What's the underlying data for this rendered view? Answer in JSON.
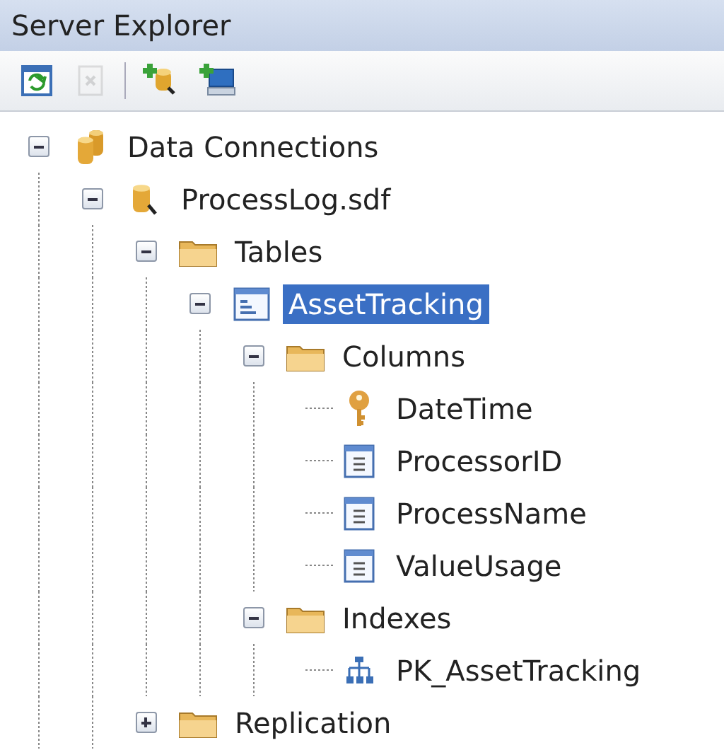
{
  "window": {
    "title": "Server Explorer"
  },
  "toolbar": [
    {
      "kind": "refresh",
      "disabled": false
    },
    {
      "kind": "delete",
      "disabled": true
    },
    {
      "kind": "add-connection",
      "disabled": false
    },
    {
      "kind": "add-server",
      "disabled": false
    }
  ],
  "tree": [
    {
      "label": "Data Connections",
      "kind": "databases",
      "expanded": true,
      "selected": false,
      "children": [
        {
          "label": "ProcessLog.sdf",
          "kind": "database",
          "expanded": true,
          "selected": false,
          "children": [
            {
              "label": "Tables",
              "kind": "folder",
              "expanded": true,
              "selected": false,
              "children": [
                {
                  "label": "AssetTracking",
                  "kind": "table",
                  "expanded": true,
                  "selected": true,
                  "children": [
                    {
                      "label": "Columns",
                      "kind": "folder",
                      "expanded": true,
                      "selected": false,
                      "children": [
                        {
                          "label": "DateTime",
                          "kind": "key",
                          "selected": false
                        },
                        {
                          "label": "ProcessorID",
                          "kind": "column",
                          "selected": false
                        },
                        {
                          "label": "ProcessName",
                          "kind": "column",
                          "selected": false
                        },
                        {
                          "label": "ValueUsage",
                          "kind": "column",
                          "selected": false
                        }
                      ]
                    },
                    {
                      "label": "Indexes",
                      "kind": "folder",
                      "expanded": true,
                      "selected": false,
                      "children": [
                        {
                          "label": "PK_AssetTracking",
                          "kind": "index",
                          "selected": false
                        }
                      ]
                    }
                  ]
                }
              ]
            },
            {
              "label": "Replication",
              "kind": "folder",
              "expanded": false,
              "selected": false
            }
          ]
        }
      ]
    }
  ]
}
